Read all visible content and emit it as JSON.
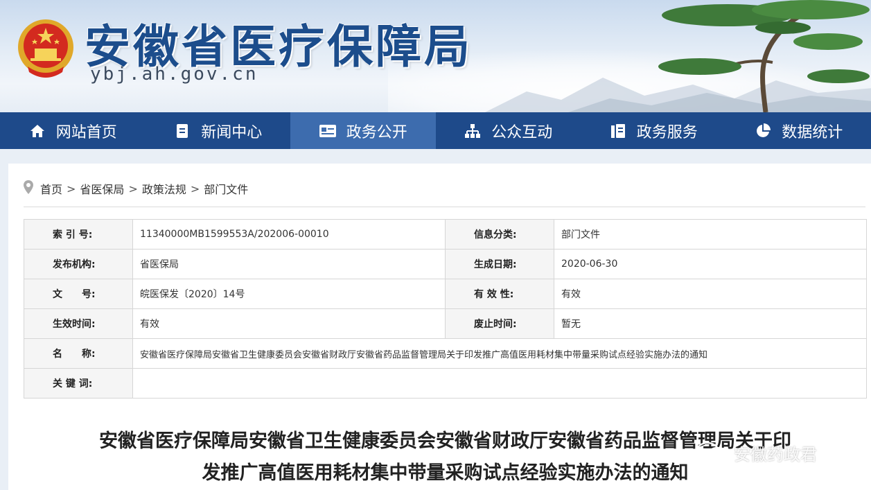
{
  "header": {
    "title": "安徽省医疗保障局",
    "domain": "ybj.ah.gov.cn"
  },
  "nav": [
    {
      "label": "网站首页",
      "icon": "home-icon"
    },
    {
      "label": "新闻中心",
      "icon": "document-icon"
    },
    {
      "label": "政务公开",
      "icon": "id-card-icon"
    },
    {
      "label": "公众互动",
      "icon": "org-chart-icon"
    },
    {
      "label": "政务服务",
      "icon": "service-icon"
    },
    {
      "label": "数据统计",
      "icon": "pie-chart-icon"
    }
  ],
  "nav_active_index": 2,
  "breadcrumb": [
    "首页",
    "省医保局",
    "政策法规",
    "部门文件"
  ],
  "breadcrumb_separator": ">",
  "meta": {
    "index_label": "索 引 号:",
    "index_value": "11340000MB1599553A/202006-00010",
    "category_label": "信息分类:",
    "category_value": "部门文件",
    "publisher_label": "发布机构:",
    "publisher_value": "省医保局",
    "date_label": "生成日期:",
    "date_value": "2020-06-30",
    "docno_label": "文　　号:",
    "docno_value": "皖医保发〔2020〕14号",
    "validity_label": "有 效 性:",
    "validity_value": "有效",
    "effective_label": "生效时间:",
    "effective_value": "有效",
    "repeal_label": "废止时间:",
    "repeal_value": "暂无",
    "name_label": "名　　称:",
    "name_value": "安徽省医疗保障局安徽省卫生健康委员会安徽省财政厅安徽省药品监督管理局关于印发推广高值医用耗材集中带量采购试点经验实施办法的通知",
    "keywords_label": "关 键 词:",
    "keywords_value": ""
  },
  "document": {
    "title_line1": "安徽省医疗保障局安徽省卫生健康委员会安徽省财政厅安徽省药品监督管理局关于印",
    "title_line2": "发推广高值医用耗材集中带量采购试点经验实施办法的通知"
  },
  "watermark": "安徽药政君",
  "colors": {
    "nav_bg": "#1e4a8a",
    "nav_active": "#3d6cae",
    "title_blue": "#1c4d8c"
  }
}
